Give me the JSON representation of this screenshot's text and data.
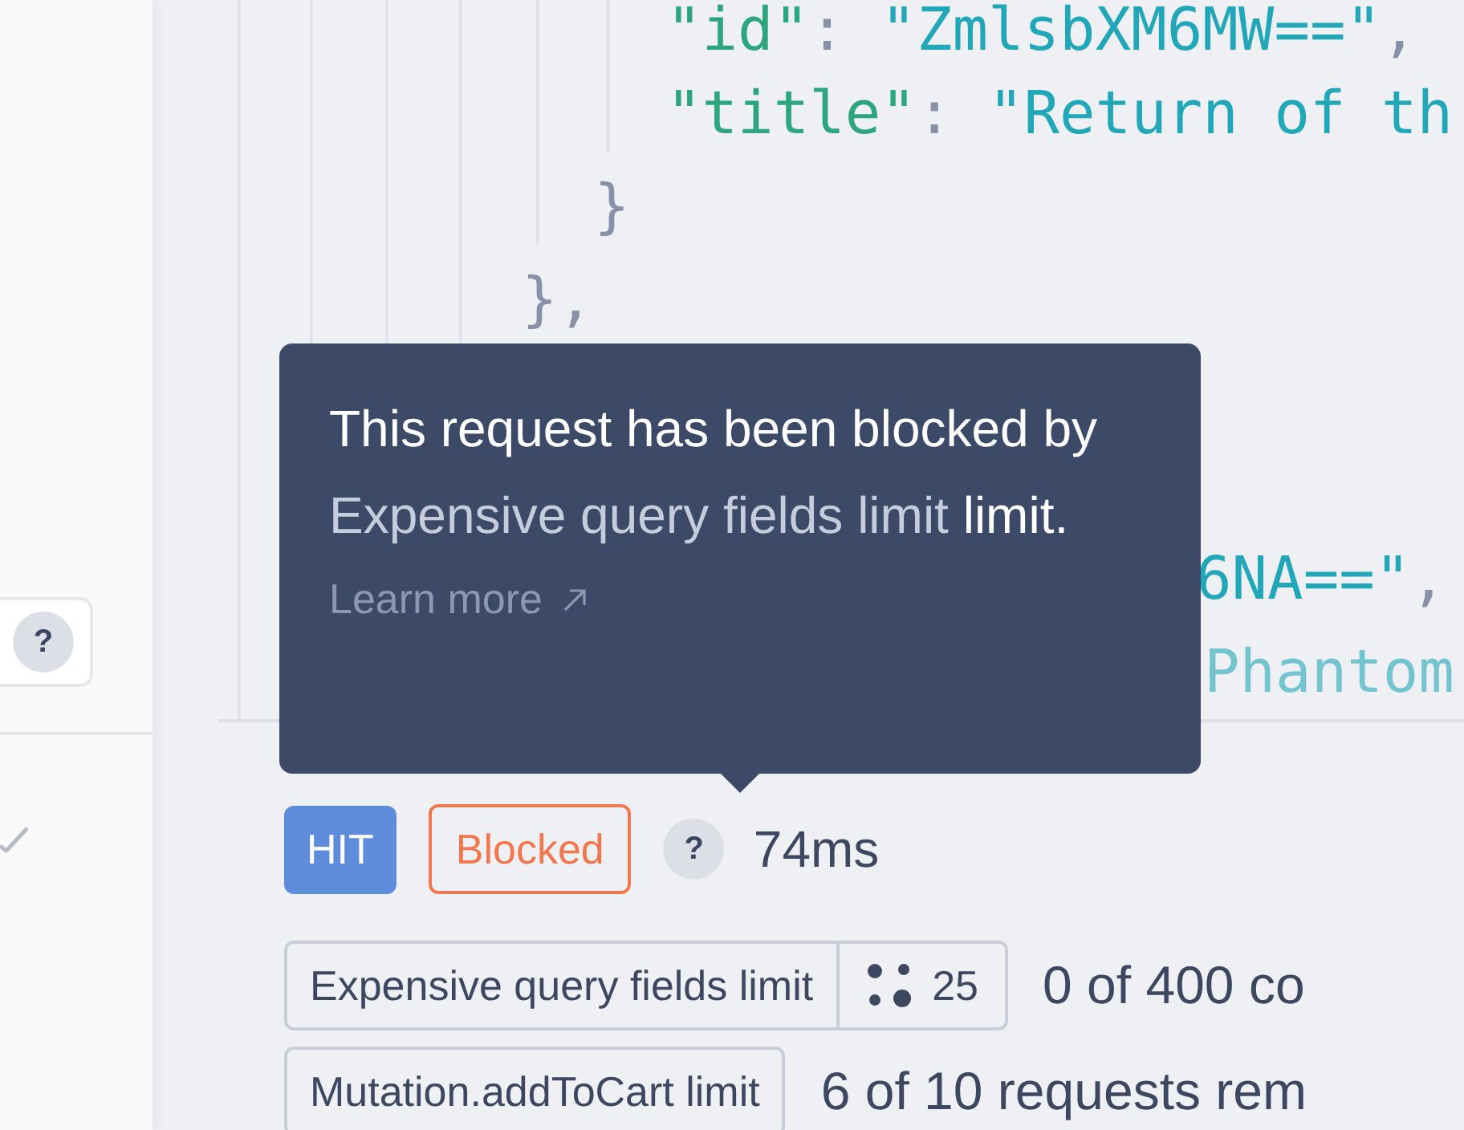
{
  "sidebar": {
    "help_button": {
      "label": "?"
    }
  },
  "code": [
    {
      "children": [
        {
          "children": [
            {
              "tokens": [
                {
                  "kind": "key",
                  "text": "\"id\""
                },
                {
                  "kind": "punct",
                  "text": ": "
                },
                {
                  "kind": "string",
                  "text": "\"ZmlsbXM6MW==\""
                },
                {
                  "kind": "punct",
                  "text": ","
                }
              ]
            },
            {
              "tokens": [
                {
                  "kind": "key",
                  "text": "\"title\""
                },
                {
                  "kind": "punct",
                  "text": ": "
                },
                {
                  "kind": "string",
                  "text": "\"Return of th"
                }
              ]
            }
          ]
        },
        {
          "tokens": [
            {
              "kind": "punct",
              "text": "}"
            }
          ]
        }
      ]
    },
    {
      "tokens": [
        {
          "kind": "punct",
          "text": "},"
        }
      ]
    },
    {
      "kind": "covered",
      "lines": [
        {
          "tokens": [
            {
              "kind": "string",
              "text": "6NA==\""
            },
            {
              "kind": "punct",
              "text": ","
            }
          ]
        },
        {
          "faded": true,
          "tokens": [
            {
              "kind": "string",
              "text": "Phantom"
            }
          ]
        }
      ]
    }
  ],
  "tooltip": {
    "before": "This request has been blocked by ",
    "link": "Expensive query fields limit",
    "after": " limit.",
    "learn_more": "Learn more"
  },
  "status": {
    "cache": "HIT",
    "result": "Blocked",
    "help": "?",
    "duration": "74ms"
  },
  "limits": [
    {
      "name": "Expensive query fields limit",
      "cost": "25",
      "detail": "0 of 400 co"
    },
    {
      "name": "Mutation.addToCart limit",
      "detail": "6 of 10 requests rem"
    }
  ]
}
